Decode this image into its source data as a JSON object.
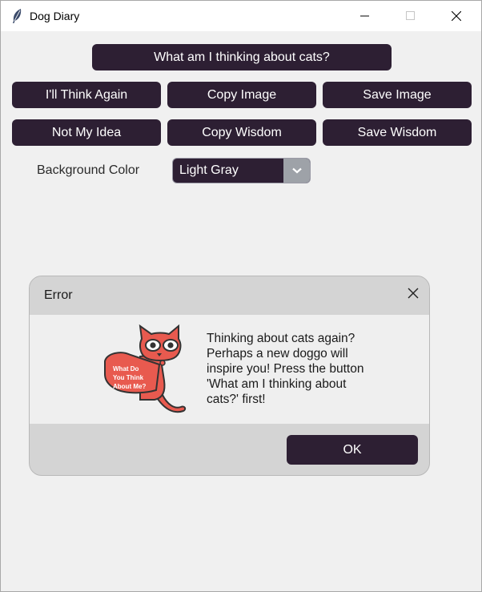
{
  "window": {
    "title": "Dog Diary",
    "icon": "feather-icon"
  },
  "main": {
    "primary_button": "What am I thinking about cats?",
    "row1": [
      "I'll Think Again",
      "Copy Image",
      "Save Image"
    ],
    "row2": [
      "Not My Idea",
      "Copy Wisdom",
      "Save Wisdom"
    ],
    "background_label": "Background Color",
    "background_value": "Light Gray"
  },
  "dialog": {
    "title": "Error",
    "message": "Thinking about cats again? Perhaps a new doggo will inspire you! Press the button 'What am I thinking about cats?' first!",
    "image_text": "What Do You Think About Me?",
    "ok_label": "OK"
  },
  "colors": {
    "button_bg": "#2d1f33",
    "button_text": "#ffffff",
    "window_bg": "#f0f0f0",
    "cat_red": "#e85a4f"
  }
}
